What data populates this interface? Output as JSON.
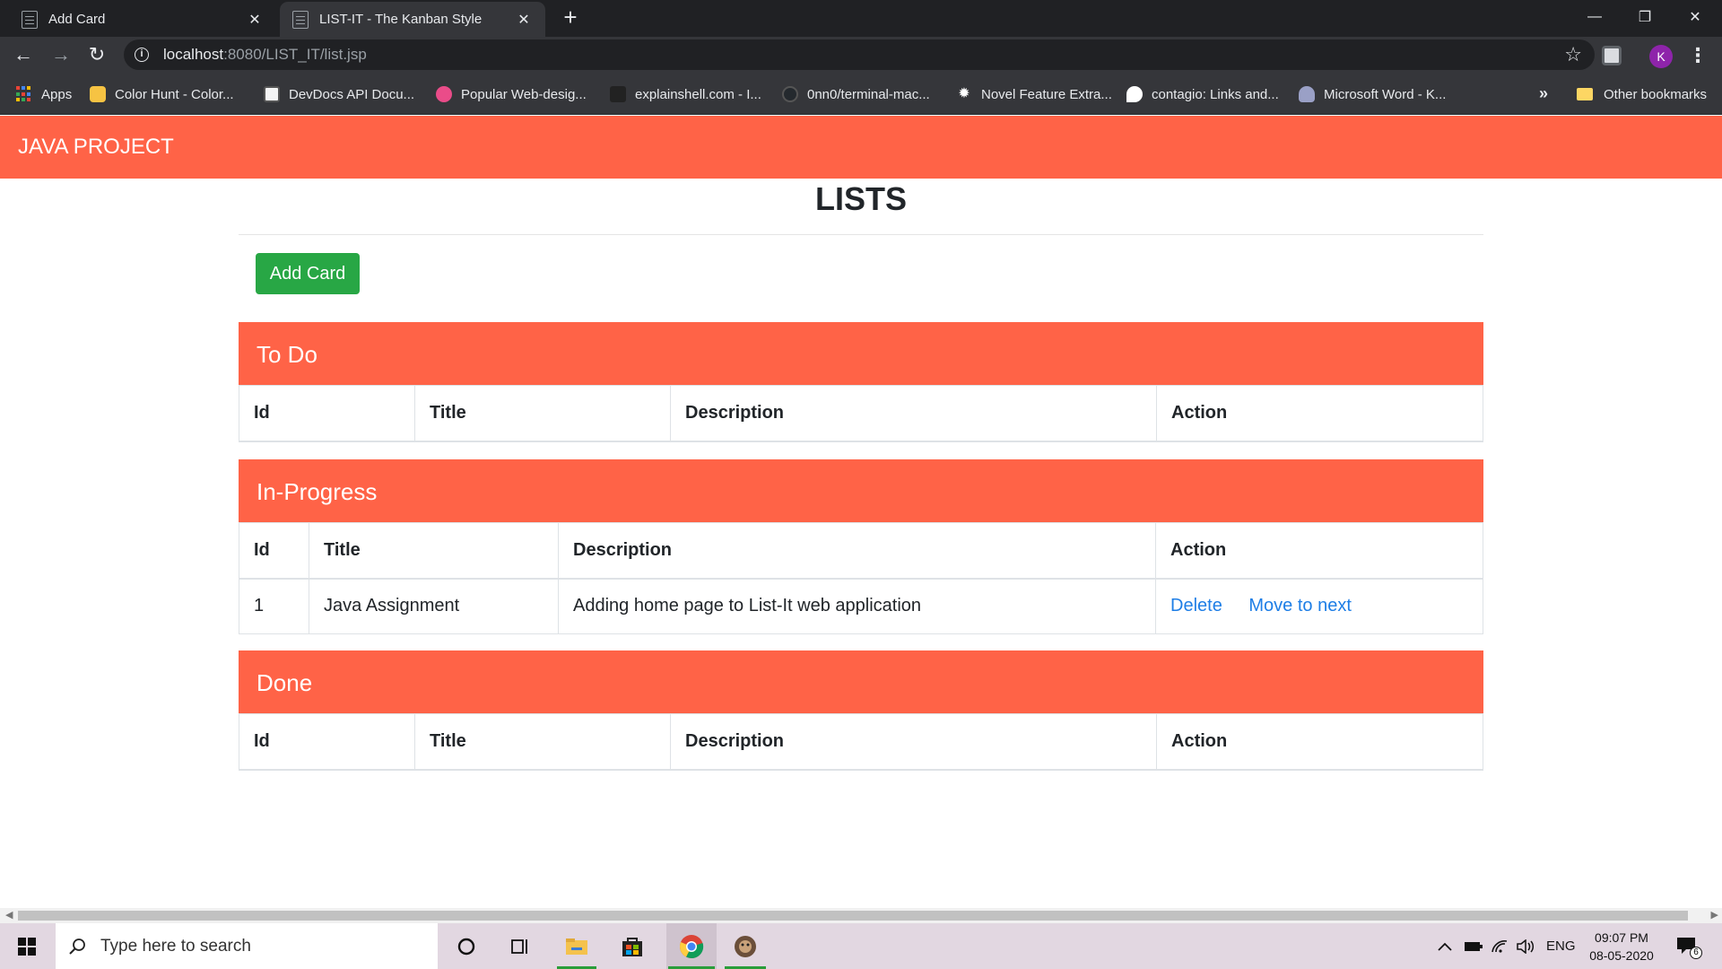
{
  "browser": {
    "tabs": [
      {
        "title": "Add Card",
        "active": false
      },
      {
        "title": "LIST-IT - The Kanban Style",
        "active": true
      }
    ],
    "url": {
      "host": "localhost",
      "rest": ":8080/LIST_IT/list.jsp"
    },
    "profile_initial": "K",
    "bookmarks": [
      {
        "label": "Apps",
        "icon": "apps-grid-icon"
      },
      {
        "label": "Color Hunt - Color...",
        "icon": "color-hunt-icon"
      },
      {
        "label": "DevDocs API Docu...",
        "icon": "devdocs-icon"
      },
      {
        "label": "Popular Web-desig...",
        "icon": "dribbble-icon"
      },
      {
        "label": "explainshell.com - I...",
        "icon": "explainshell-icon"
      },
      {
        "label": "0nn0/terminal-mac...",
        "icon": "github-icon"
      },
      {
        "label": "Novel Feature Extra...",
        "icon": "gear-icon"
      },
      {
        "label": "contagio: Links and...",
        "icon": "contagio-icon"
      },
      {
        "label": "Microsoft Word - K...",
        "icon": "headset-icon"
      }
    ],
    "other_bookmarks": "Other bookmarks",
    "more": "»"
  },
  "app": {
    "brand": "JAVA PROJECT",
    "page_title": "LISTS",
    "add_card_label": "Add Card",
    "colors": {
      "nav": "#ff6347",
      "add_button": "#28a745",
      "link": "#1e7ee6"
    }
  },
  "boards": {
    "todo": {
      "title": "To Do",
      "columns": [
        "Id",
        "Title",
        "Description",
        "Action"
      ],
      "rows": []
    },
    "inprogress": {
      "title": "In-Progress",
      "columns": [
        "Id",
        "Title",
        "Description",
        "Action"
      ],
      "rows": [
        {
          "id": "1",
          "title": "Java Assignment",
          "description": "Adding home page to List-It web application",
          "actions": [
            "Delete",
            "Move to next"
          ]
        }
      ]
    },
    "done": {
      "title": "Done",
      "columns": [
        "Id",
        "Title",
        "Description",
        "Action"
      ],
      "rows": []
    }
  },
  "taskbar": {
    "search_placeholder": "Type here to search",
    "language": "ENG",
    "time": "09:07 PM",
    "date": "08-05-2020",
    "notification_count": "6"
  }
}
